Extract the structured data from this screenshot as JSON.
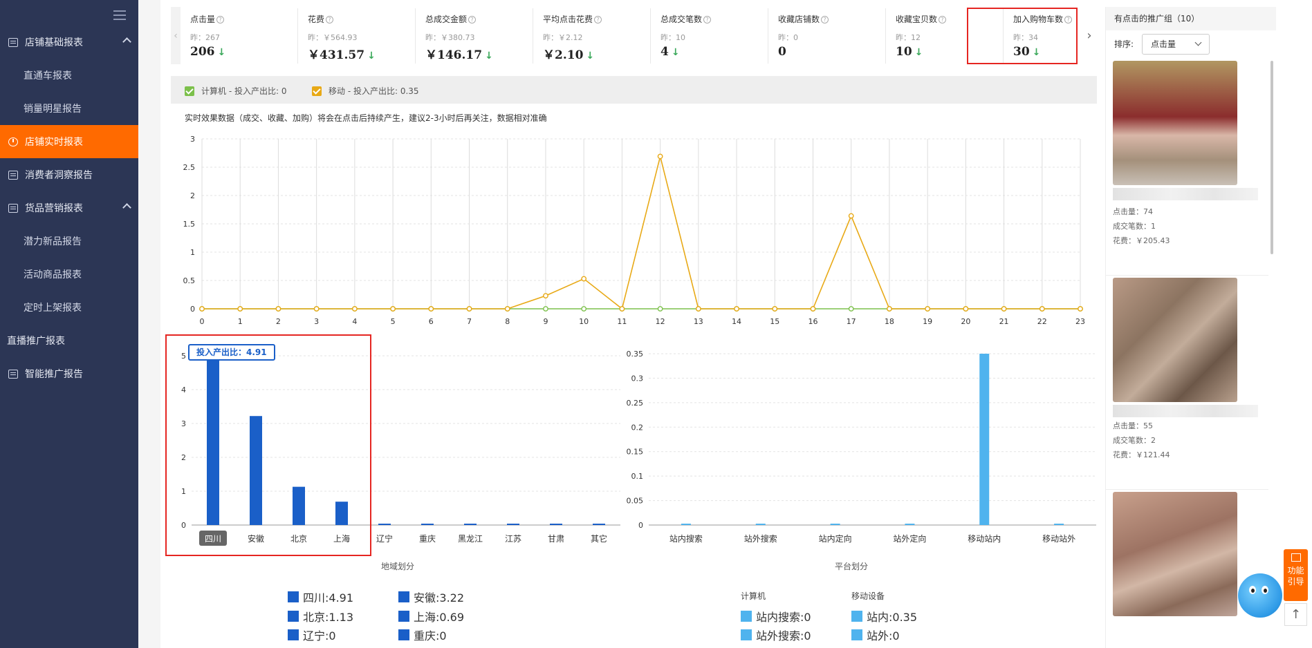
{
  "sidebar": {
    "items": [
      {
        "label": "店铺基础报表",
        "type": "group",
        "icon": "report-icon"
      },
      {
        "label": "直通车报表",
        "type": "sub"
      },
      {
        "label": "销量明星报告",
        "type": "sub"
      },
      {
        "label": "店铺实时报表",
        "type": "active",
        "icon": "pie-chart-icon"
      },
      {
        "label": "消费者洞察报告",
        "type": "group-plain",
        "icon": "report-icon"
      },
      {
        "label": "货品营销报表",
        "type": "group",
        "icon": "chart-report-icon"
      },
      {
        "label": "潜力新品报告",
        "type": "sub"
      },
      {
        "label": "活动商品报表",
        "type": "sub"
      },
      {
        "label": "定时上架报表",
        "type": "sub"
      },
      {
        "label": "直播推广报表",
        "type": "plain"
      },
      {
        "label": "智能推广报告",
        "type": "group-plain",
        "icon": "report-icon"
      }
    ]
  },
  "metrics": [
    {
      "name": "点击量",
      "yesterday": "昨：267",
      "value": "206"
    },
    {
      "name": "花费",
      "yesterday": "昨：￥564.93",
      "value": "￥431.57"
    },
    {
      "name": "总成交金额",
      "yesterday": "昨：￥380.73",
      "value": "￥146.17"
    },
    {
      "name": "平均点击花费",
      "yesterday": "昨：￥2.12",
      "value": "￥2.10"
    },
    {
      "name": "总成交笔数",
      "yesterday": "昨：10",
      "value": "4"
    },
    {
      "name": "收藏店铺数",
      "yesterday": "昨：0",
      "value": "0"
    },
    {
      "name": "收藏宝贝数",
      "yesterday": "昨：12",
      "value": "10"
    },
    {
      "name": "加入购物车数",
      "yesterday": "昨：34",
      "value": "30"
    }
  ],
  "legend": {
    "pc_label": "计算机 - 投入产出比: 0",
    "mobile_label": "移动 - 投入产出比: 0.35",
    "pc_color": "#7cc04b",
    "mobile_color": "#e8a916"
  },
  "note": "实时效果数据（成交、收藏、加购）将会在点击后持续产生，建议2-3小时后再关注，数据相对准确",
  "right_panel": {
    "title": "有点击的推广组（10）",
    "sort_label": "排序:",
    "sort_value": "点击量",
    "cards": [
      {
        "clicks": "点击量：74",
        "deals": "成交笔数：1",
        "cost": "花费：￥205.43"
      },
      {
        "clicks": "点击量：55",
        "deals": "成交笔数：2",
        "cost": "花费：￥121.44"
      }
    ]
  },
  "region": {
    "title": "地域划分",
    "tooltip": "投入产出比：4.91",
    "highlighted": "四川",
    "legend_items": [
      "四川:4.91",
      "安徽:3.22",
      "北京:1.13",
      "上海:0.69",
      "辽宁:0",
      "重庆:0"
    ]
  },
  "platform": {
    "title": "平台划分",
    "pc_header": "计算机",
    "mobile_header": "移动设备",
    "pc_items": [
      "站内搜索:0",
      "站外搜索:0"
    ],
    "mobile_items": [
      "站内:0.35",
      "站外:0"
    ]
  },
  "float": {
    "guide_label_1": "功能",
    "guide_label_2": "引导",
    "up_icon": "arrow-up-icon"
  },
  "chart_data": [
    {
      "type": "line",
      "x": [
        0,
        1,
        2,
        3,
        4,
        5,
        6,
        7,
        8,
        9,
        10,
        11,
        12,
        13,
        14,
        15,
        16,
        17,
        18,
        19,
        20,
        21,
        22,
        23
      ],
      "series": [
        {
          "name": "计算机",
          "color": "#7cc04b",
          "values": [
            0,
            0,
            0,
            0,
            0,
            0,
            0,
            0,
            0,
            0,
            0,
            0,
            0,
            0,
            0,
            0,
            0,
            0,
            0,
            0,
            0,
            0,
            0,
            0
          ]
        },
        {
          "name": "移动",
          "color": "#e8a916",
          "values": [
            0,
            0,
            0,
            0,
            0,
            0,
            0,
            0,
            0,
            0.23,
            0.53,
            0,
            2.69,
            0,
            0,
            0,
            0,
            1.64,
            0,
            0,
            0,
            0,
            0,
            0
          ]
        }
      ],
      "yticks": [
        0,
        0.5,
        1,
        1.5,
        2,
        2.5,
        3
      ],
      "ylim": [
        0,
        3
      ],
      "grid": true
    },
    {
      "type": "bar",
      "title": "地域划分",
      "categories": [
        "四川",
        "安徽",
        "北京",
        "上海",
        "辽宁",
        "重庆",
        "黑龙江",
        "江苏",
        "甘肃",
        "其它"
      ],
      "values": [
        4.91,
        3.22,
        1.13,
        0.69,
        0,
        0,
        0,
        0,
        0,
        0
      ],
      "yticks": [
        0,
        1,
        2,
        3,
        4,
        5
      ],
      "ylim": [
        0,
        5
      ],
      "color": "#1a5fc8"
    },
    {
      "type": "bar",
      "title": "平台划分",
      "categories": [
        "站内搜索",
        "站外搜索",
        "站内定向",
        "站外定向",
        "移动站内",
        "移动站外"
      ],
      "values": [
        0,
        0,
        0,
        0,
        0.35,
        0
      ],
      "yticks": [
        0,
        0.05,
        0.1,
        0.15,
        0.2,
        0.25,
        0.3,
        0.35
      ],
      "ylim": [
        0,
        0.35
      ],
      "color": "#4fb3ee"
    }
  ]
}
